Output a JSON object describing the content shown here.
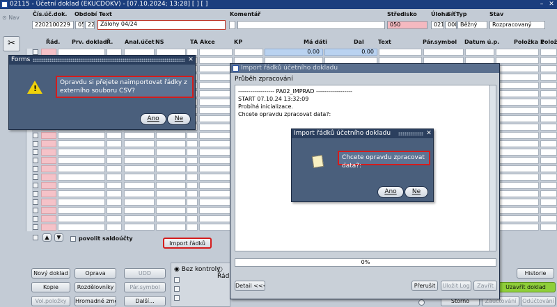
{
  "window": {
    "title": "02115 - Účetní doklad (EKUCDOKV) - [07.10.2024; 13:28]  [ ]  [ ]"
  },
  "nav": {
    "label": "Nav"
  },
  "header": {
    "labels": {
      "doc_no": "Čís.úč.dok.",
      "period": "Období",
      "text": "Text",
      "comment": "Komentář",
      "center": "Středisko",
      "level": "Úloha",
      "network": "Síť",
      "type": "Typ",
      "status": "Stav"
    },
    "values": {
      "doc_no": "2202100229",
      "period_a": "05",
      "period_b": "22",
      "text": "Zálohy 04/24",
      "comment": "",
      "center": "050",
      "level": "021",
      "network": "000",
      "type": "Běžný",
      "status": "Rozpracovaný"
    }
  },
  "grid": {
    "columns": [
      "Řád.",
      "Prv. doklad",
      "Ř.",
      "Anal.účet",
      "NS",
      "TA",
      "Akce",
      "KP",
      "Má dáti",
      "Dal",
      "Text",
      "Pár.symbol",
      "Datum ú.p.",
      "Položka 1",
      "Polož"
    ],
    "first_row": {
      "ma_dati": "0.00",
      "dal": "0.00"
    },
    "pair_checkbox_label": "povolit saldoúčty",
    "import_button": "Import řádků"
  },
  "bottom": {
    "buttons": [
      "Nový doklad",
      "Oprava",
      "UDD",
      "Kopie",
      "Rozdělovníky",
      "Pár.symbol",
      "Vol.položky",
      "Hromadné změ...",
      "Další..."
    ],
    "radio_label": "Bez kontroly",
    "radio2_label": "Řád",
    "right_buttons": [
      "Historie",
      "Uzavřít doklad",
      "Storno",
      "Zaúčtování",
      "Odúčtování"
    ]
  },
  "forms_dialog": {
    "title": "Forms",
    "message": "Opravdu si přejete naimportovat řádky z externího souboru CSV?",
    "yes": "Ano",
    "no": "Ne"
  },
  "import_window": {
    "title": "Import řádků účetního dokladu",
    "section": "Průběh zpracování",
    "log": [
      "------------------ PA02_IMPRAD ------------------",
      "START 07.10.24 13:32:09",
      "Probíhá inicializace.",
      "Chcete opravdu zpracovat data?:"
    ],
    "progress": "0%",
    "progress_value": 0,
    "detail_button": "Detail <<<<",
    "pause_button": "Přerušit",
    "save_log_button": "Uložit Log",
    "close_button": "Zavřít"
  },
  "confirm_dialog": {
    "title": "Import řádků účetního dokladu",
    "message": "Chcete opravdu zpracovat data?:",
    "yes": "Ano",
    "no": "Ne"
  },
  "colors": {
    "titlebar": "#1b3e7e",
    "dialog": "#4a5f7c",
    "highlight": "#d41c1c",
    "green": "#8fcf3a",
    "pink": "#f4b9c0"
  }
}
